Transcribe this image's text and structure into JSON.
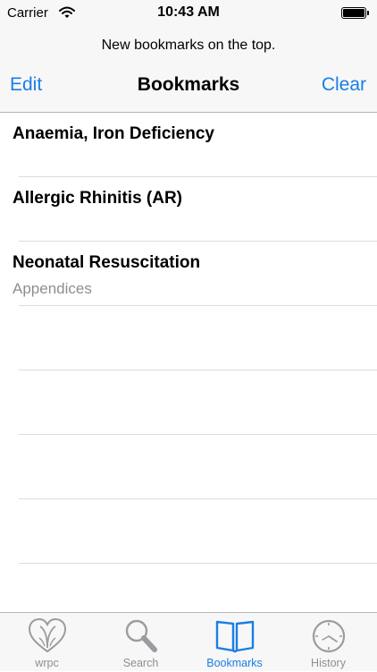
{
  "status_bar": {
    "carrier": "Carrier",
    "time": "10:43 AM",
    "wifi_icon": "wifi-icon",
    "battery_icon": "battery-icon"
  },
  "nav": {
    "prompt": "New bookmarks on the top.",
    "title": "Bookmarks",
    "left_button": "Edit",
    "right_button": "Clear",
    "accent_color": "#1a7ee6"
  },
  "bookmarks": [
    {
      "title": "Anaemia, Iron Deficiency"
    },
    {
      "title": "Allergic Rhinitis (AR)"
    },
    {
      "title": "Neonatal Resuscitation"
    }
  ],
  "section_note": "Appendices",
  "tabs": [
    {
      "label": "wrpc",
      "icon": "heart-icon",
      "active": false
    },
    {
      "label": "Search",
      "icon": "magnifier-icon",
      "active": false
    },
    {
      "label": "Bookmarks",
      "icon": "open-book-icon",
      "active": true
    },
    {
      "label": "History",
      "icon": "clock-icon",
      "active": false
    }
  ]
}
